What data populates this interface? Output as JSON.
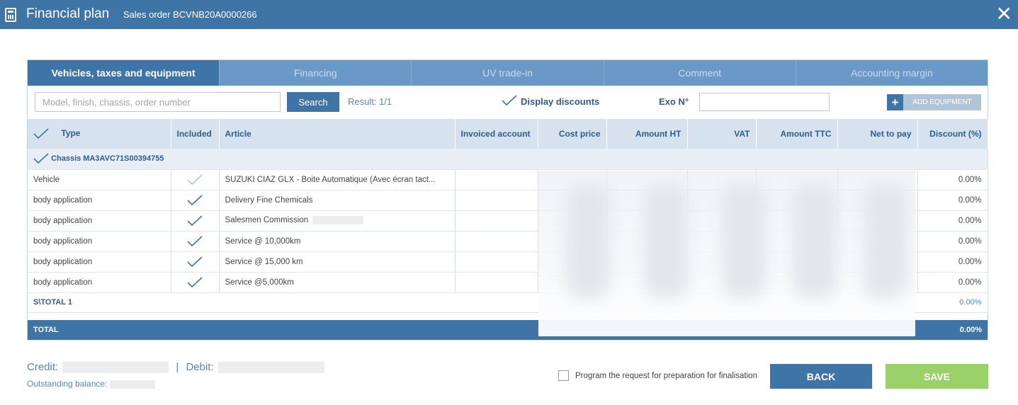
{
  "window": {
    "title": "Financial plan",
    "subtitle": "Sales order BCVNB20A0000266",
    "close_glyph": "✕"
  },
  "tabs": [
    {
      "label": "Vehicles, taxes and equipment",
      "active": true
    },
    {
      "label": "Financing",
      "active": false
    },
    {
      "label": "UV trade-in",
      "active": false
    },
    {
      "label": "Comment",
      "active": false
    },
    {
      "label": "Accounting margin",
      "active": false
    }
  ],
  "toolbar": {
    "search_placeholder": "Model, finish, chassis, order number",
    "search_label": "Search",
    "result": "Result: 1/1",
    "display_discounts_label": "Display discounts",
    "display_discounts_checked": true,
    "exo_label": "Exo N°",
    "exo_value": "",
    "add_equipment_label": "ADD EQUIPMENT"
  },
  "table": {
    "columns": [
      "Type",
      "Included",
      "Article",
      "Invoiced account",
      "Cost price",
      "Amount HT",
      "VAT",
      "Amount TTC",
      "Net to pay",
      "Discount (%)"
    ],
    "chassis_label": "Chassis MA3AVC71S00394755",
    "rows": [
      {
        "type": "Vehicle",
        "included": true,
        "article": "SUZUKI CIAZ GLX - Boite Automatique (Avec écran tact...",
        "discount": "0.00%"
      },
      {
        "type": "body application",
        "included": true,
        "article": "Delivery Fine Chemicals",
        "discount": "0.00%"
      },
      {
        "type": "body application",
        "included": true,
        "article": "Salesmen Commission",
        "discount": "0.00%"
      },
      {
        "type": "body application",
        "included": true,
        "article": "Service @ 10,000km",
        "discount": "0.00%"
      },
      {
        "type": "body application",
        "included": true,
        "article": "Service @ 15,000 km",
        "discount": "0.00%"
      },
      {
        "type": "body application",
        "included": true,
        "article": "Service @5,000km",
        "discount": "0.00%"
      }
    ],
    "subtotal_label": "S\\TOTAL 1",
    "subtotal_discount": "0.00%",
    "total_label": "TOTAL",
    "total_discount": "0.00%"
  },
  "footer": {
    "credit_label": "Credit:",
    "separator": "|",
    "debit_label": "Debit:",
    "balance_label": "Outstanding balance:",
    "program_label": "Program the request for preparation for finalisation",
    "back_label": "BACK",
    "save_label": "SAVE"
  },
  "colors": {
    "primary": "#3e74a6",
    "tab_inactive": "#6a99c7",
    "header_bg": "#d6e2ee",
    "save": "#9bd169"
  }
}
